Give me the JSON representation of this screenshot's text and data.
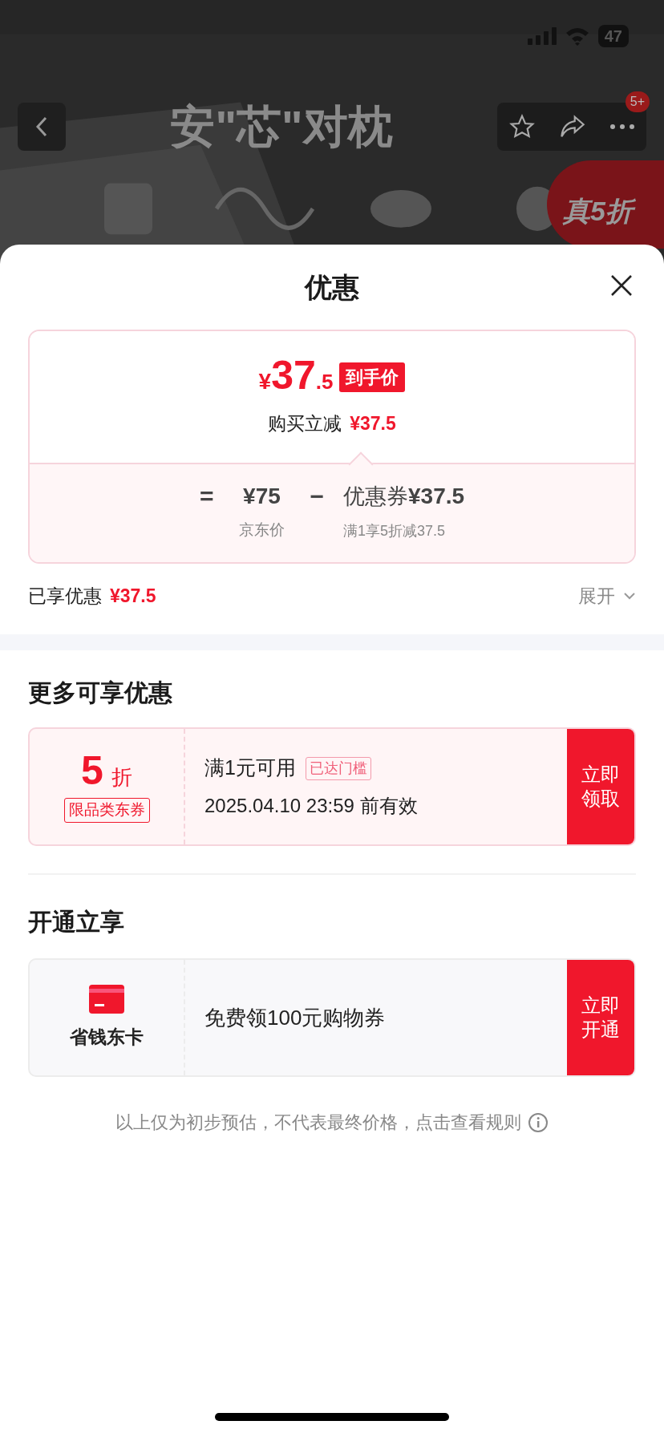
{
  "status_bar": {
    "battery": "47"
  },
  "product_header": {
    "title": "安\"芯\"对枕",
    "more_badge": "5+",
    "promo_badge": "真5折"
  },
  "sheet": {
    "title": "优惠",
    "price_card": {
      "currency": "¥",
      "price_int": "37",
      "price_dec": ".5",
      "price_tag": "到手价",
      "instant_label": "购买立减",
      "instant_amount": "¥37.5",
      "equals": "=",
      "base_price": "¥75",
      "base_label": "京东价",
      "minus": "−",
      "coupon_name": "优惠券",
      "coupon_amount": "¥37.5",
      "coupon_rule": "满1享5折减37.5"
    },
    "enjoyed": {
      "label": "已享优惠",
      "amount": "¥37.5",
      "expand": "展开",
      "expanded": false
    },
    "more_title": "更多可享优惠",
    "coupons": [
      {
        "kind": "discount",
        "value": "5",
        "unit": "折",
        "tag": "限品类东券",
        "condition": "满1元可用",
        "badge": "已达门槛",
        "validity": "2025.04.10 23:59 前有效",
        "action": "立即领取"
      }
    ],
    "open_title": "开通立享",
    "memberships": [
      {
        "name": "省钱东卡",
        "offer": "免费领100元购物券",
        "action": "立即开通"
      }
    ],
    "footer_note": "以上仅为初步预估，不代表最终价格，点击查看规则"
  }
}
